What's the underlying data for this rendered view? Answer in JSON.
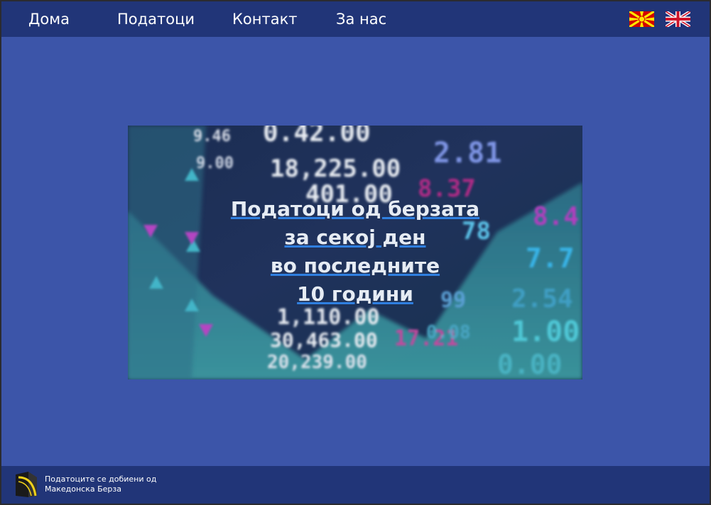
{
  "nav": {
    "items": [
      {
        "label": "Дома"
      },
      {
        "label": "Податоци"
      },
      {
        "label": "Контакт"
      },
      {
        "label": "За нас"
      }
    ],
    "languages": [
      {
        "icon": "macedonia-flag-icon"
      },
      {
        "icon": "uk-flag-icon"
      }
    ]
  },
  "hero": {
    "title_lines": [
      "Податоци од берзата",
      "за секој ден",
      "во последните",
      "10 години"
    ],
    "background_numbers": [
      "9.46",
      "0.42.00",
      "18,225.00",
      "401.00",
      "2.81",
      "8.37",
      "8.4",
      "78",
      "7.7",
      "9.00",
      "1,110.00",
      "30,463.00",
      "20,239.00",
      "17.21",
      "0.08",
      "1.00",
      "2.54",
      "0.00",
      "99"
    ]
  },
  "footer": {
    "logo_icon": "macedonian-stock-exchange-logo-icon",
    "line1": "Податоците се добиени од",
    "line2": "Македонска Берза"
  },
  "colors": {
    "background": "#3c55a9",
    "bar": "#213578",
    "text": "#ffffff",
    "underline": "#2f7fe0"
  }
}
